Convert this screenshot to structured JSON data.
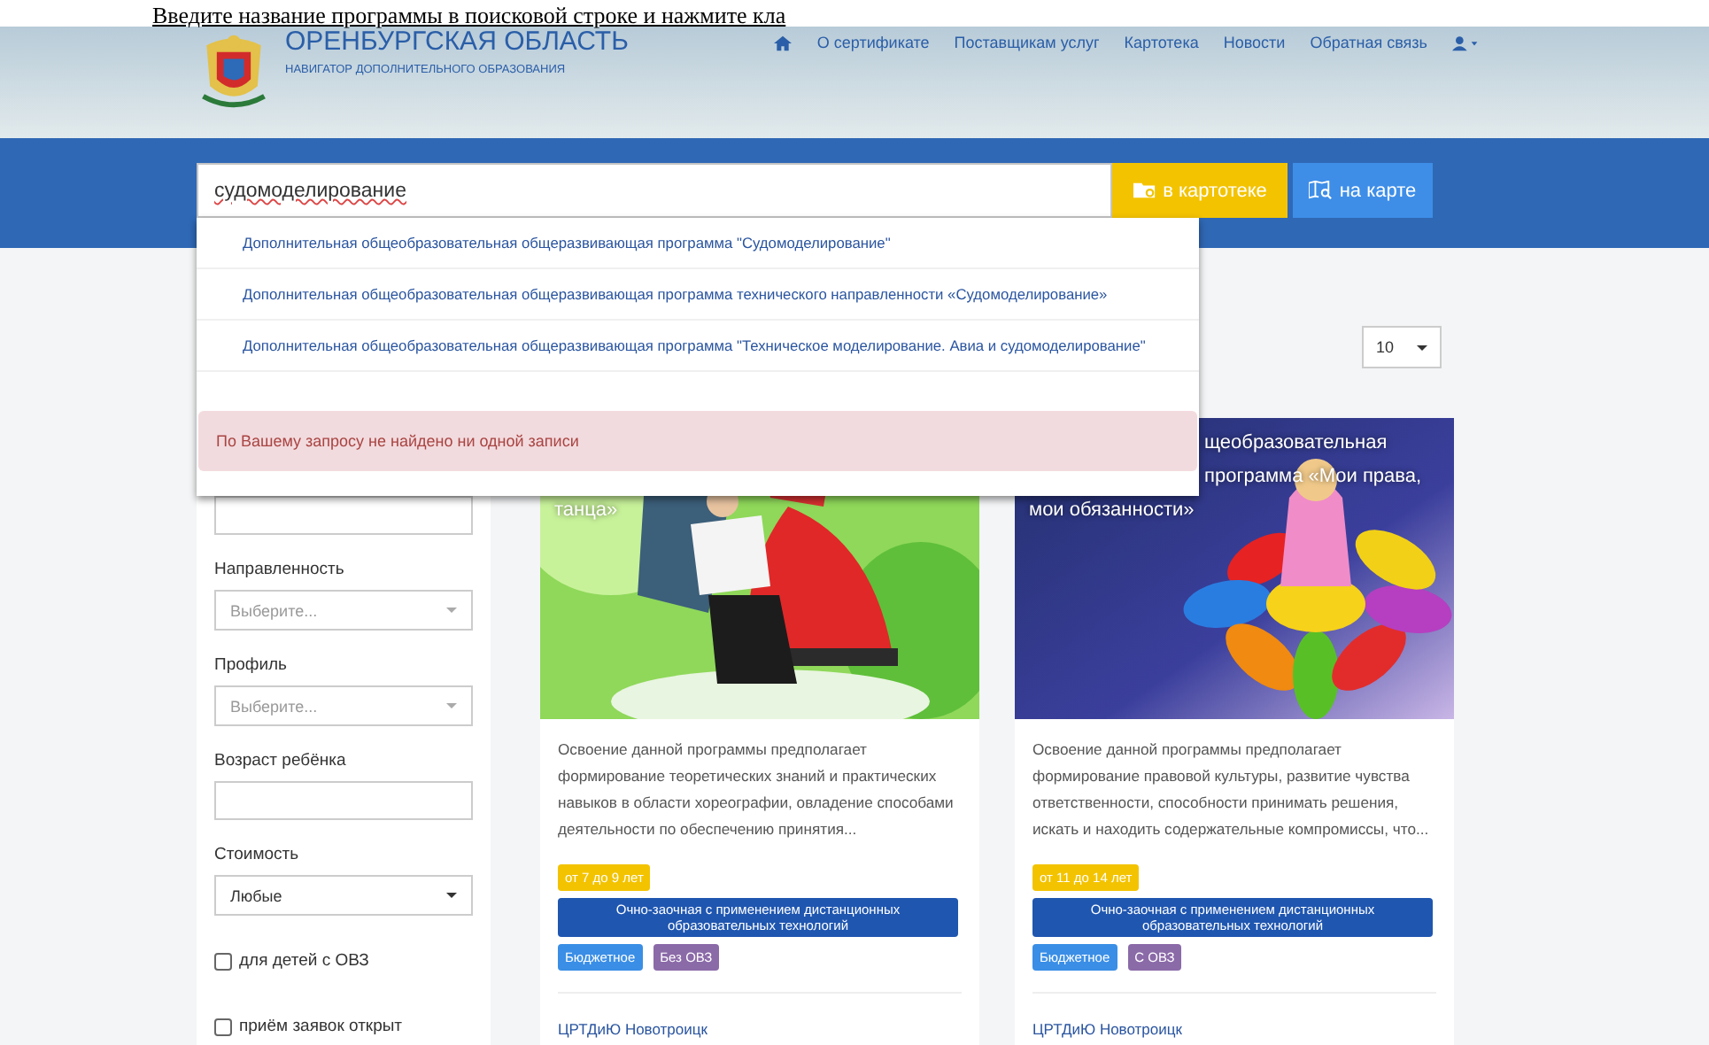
{
  "doc_caption": "Введите название программы в поисковой строке и нажмите кла",
  "header": {
    "title": "ОРЕНБУРГСКАЯ ОБЛАСТЬ",
    "subtitle": "НАВИГАТОР ДОПОЛНИТЕЛЬНОГО ОБРАЗОВАНИЯ",
    "nav": [
      {
        "kind": "home"
      },
      {
        "kind": "link",
        "label": "О сертификате"
      },
      {
        "kind": "link",
        "label": "Поставщикам услуг"
      },
      {
        "kind": "link",
        "label": "Картотека"
      },
      {
        "kind": "link",
        "label": "Новости"
      },
      {
        "kind": "link",
        "label": "Обратная связь"
      },
      {
        "kind": "user"
      }
    ]
  },
  "search": {
    "value": "судомоделирование",
    "buttons": [
      {
        "kind": "catalog",
        "label": "в картотеке"
      },
      {
        "kind": "map",
        "label": "на карте"
      }
    ],
    "suggestions": [
      "Дополнительная общеобразовательная общеразвивающая программа \"Судомоделирование\"",
      "Дополнительная общеобразовательная общеразвивающая программа технического направленности «Судомоделирование»",
      "Дополнительная общеобразовательная общеразвивающая программа \"Техническое моделирование. Авиа и судомоделирование\""
    ],
    "alert": "По Вашему запросу не найдено ни одной записи"
  },
  "filters": [
    {
      "kind": "input"
    },
    {
      "kind": "select",
      "label": "Направленность",
      "placeholder": "Выберите..."
    },
    {
      "kind": "select",
      "label": "Профиль",
      "placeholder": "Выберите..."
    },
    {
      "kind": "input",
      "label": "Возраст ребёнка"
    },
    {
      "kind": "select",
      "label": "Стоимость",
      "value": "Любые"
    },
    {
      "kind": "checkbox",
      "label": "для детей с ОВЗ",
      "checked": false
    },
    {
      "kind": "checkbox",
      "label": "приём заявок открыт",
      "checked": false
    }
  ],
  "page_size": "10",
  "cards": [
    {
      "title_lines": [
        {
          "kind": "full",
          "text": "танца»"
        }
      ],
      "description": "Освоение данной программы предполагает формирование теоретических знаний и практических навыков в области хореографии, овладение  способами  деятельности по обеспечению принятия...",
      "age": "от 7 до 9 лет",
      "format": "Очно-заочная с применением дистанционных образовательных технологий",
      "tags": [
        {
          "text": "Бюджетное",
          "color": "#3a8ee6"
        },
        {
          "text": "Без ОВЗ",
          "color": "#8b6aa8"
        }
      ],
      "provider": "ЦРТДиЮ Новотроицк"
    },
    {
      "title_lines": [
        {
          "kind": "partial",
          "text": "щеобразовательная"
        },
        {
          "kind": "partial",
          "text": "программа «Мои права,"
        },
        {
          "kind": "full",
          "text": "мои обязанности»"
        }
      ],
      "description": "Освоение данной программы предполагает формирование правовой культуры, развитие чувства ответственности, способности принимать решения, искать и находить содержательные компромиссы, что...",
      "age": "от 11 до 14 лет",
      "format": "Очно-заочная с применением дистанционных образовательных технологий",
      "tags": [
        {
          "text": "Бюджетное",
          "color": "#3a8ee6"
        },
        {
          "text": "С ОВЗ",
          "color": "#8b6aa8"
        }
      ],
      "provider": "ЦРТДиЮ Новотроицк"
    }
  ]
}
